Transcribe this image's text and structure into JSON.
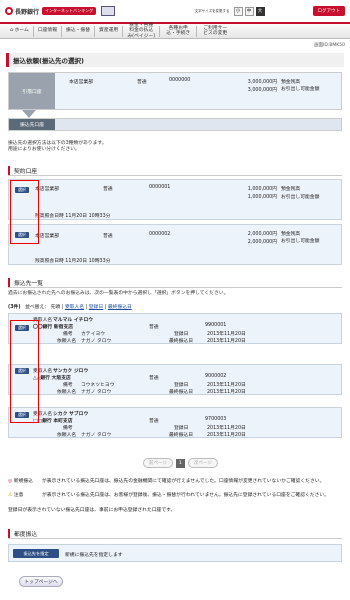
{
  "header": {
    "bank_name": "長野銀行",
    "service_badge": "インターネットバンキング",
    "font_size_label": "文字サイズを変更する",
    "font_sizes": [
      "小",
      "中",
      "大"
    ],
    "font_size_selected": "中",
    "logout_label": "ログアウト"
  },
  "nav": {
    "items": [
      "ホーム",
      "口座情報",
      "振込・振替",
      "資産運用",
      "税金・各種料金の払込み(ペイジー)",
      "各種お申込・手続き",
      "ご利用サービスの変更"
    ]
  },
  "screen_id": "画面ID:BMK50",
  "page_title": "振込依頼(振込先の選択)",
  "step1": {
    "tag": "引落口座",
    "branch": "本店営業部",
    "type": "普通",
    "number": "0000000",
    "amount1": "3,000,000円",
    "label1": "預金残高",
    "amount2": "3,000,000円",
    "label2": "お引出し可能金額"
  },
  "step2": {
    "tag": "振込先口座"
  },
  "intro": [
    "振込先の選択方法は以下の3種類があります。",
    "用途によりお使い分けください。"
  ],
  "contract_section": {
    "title": "契約口座"
  },
  "select_label": "選択",
  "contract_accounts": [
    {
      "branch": "本店営業部",
      "type": "普通",
      "number": "0000001",
      "amount1": "1,000,000円",
      "label1": "預金残高",
      "amount2": "1,000,000円",
      "label2": "お引出し可能金額",
      "timestamp": "残高照会日時 11月20日 10時33分"
    },
    {
      "branch": "本店営業部",
      "type": "普通",
      "number": "0000002",
      "amount1": "2,000,000円",
      "label1": "預金残高",
      "amount2": "2,000,000円",
      "label2": "お引出し可能金額",
      "timestamp": "残高照会日時 11月20日 10時33分"
    }
  ],
  "payee_section": {
    "title": "振込先一覧",
    "description": "過去にお振込された先へのお振込みは、次の一覧表の中から選択し「選択」ボタンを押してください。",
    "count": "(3件)",
    "sort_label": "並べ替え：",
    "sort_options": [
      "先頭",
      "受取人名",
      "登録日",
      "最終振込日"
    ]
  },
  "labels": {
    "payee_name": "受取人名",
    "memo": "備考",
    "requester": "依頼人名",
    "registered": "登録日",
    "last_transfer": "最終振込日"
  },
  "payees": [
    {
      "name": "マルマル イチロウ",
      "bank": "〇〇銀行 新宿支店",
      "type": "普通",
      "number": "9900001",
      "memo": "カテイヨウ",
      "requester": "ナガノ タロウ",
      "registered": "2013年11月20日",
      "last": "2013年11月20日"
    },
    {
      "name": "サンカク ジロウ",
      "bank": "△△銀行 大阪支店",
      "type": "普通",
      "number": "9000002",
      "memo": "コウネツヒヨウ",
      "requester": "ナガノ タロウ",
      "registered": "2013年11月20日",
      "last": "2013年11月20日"
    },
    {
      "name": "シカク サブロウ",
      "bank": "□□銀行 本町支店",
      "type": "普通",
      "number": "9700003",
      "memo": "",
      "requester": "ナガノ タロウ",
      "registered": "2013年11月20日",
      "last": "2013年11月20日"
    }
  ],
  "pager": {
    "prev": "前ページ",
    "current": "1",
    "next": "次ページ"
  },
  "legend": [
    {
      "key": "新規振込",
      "text": "が表示されている振込先口座は、振込先の金融機関にて確認が行えませんでした。口座情報が変更されていないかご確認ください。"
    },
    {
      "key": "注意",
      "text": "が表示されている振込先口座は、お客様が登録後、振込・振替が行われていません。振込先に登録されている口座をご確認ください。"
    },
    {
      "key": "",
      "text": "登録日が表示されていない振込先口座は、事前にお申込登録された口座です。"
    }
  ],
  "once_section": {
    "title": "都度振込",
    "button": "振込先を指定",
    "text": "新規に振込先を指定します"
  },
  "top_button": "トップページへ",
  "colors": {
    "brand_red": "#c8102e",
    "select_blue": "#2d4f86",
    "panel_bg": "#edf3fb",
    "highlight_frame": "#e00000"
  }
}
